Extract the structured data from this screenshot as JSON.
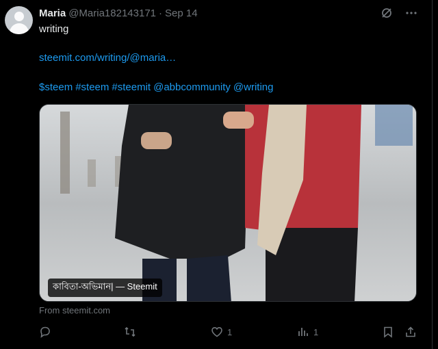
{
  "user": {
    "name": "Maria",
    "handle": "@Maria182143171",
    "separator": "·",
    "date": "Sep 14"
  },
  "tweet": {
    "line1": "writing",
    "link": "steemit.com/writing/@maria…",
    "hashtags": [
      "$steem",
      "#steem",
      "#steemit",
      "@abbcommunity",
      "@writing"
    ]
  },
  "card": {
    "title": "কাবিতা-অভিমান| — Steemit",
    "source": "From steemit.com"
  },
  "actions": {
    "likes": "1",
    "views": "1"
  },
  "icons": [
    "grok-icon",
    "more-icon",
    "reply-icon",
    "retweet-icon",
    "like-icon",
    "views-icon",
    "bookmark-icon",
    "share-icon"
  ]
}
